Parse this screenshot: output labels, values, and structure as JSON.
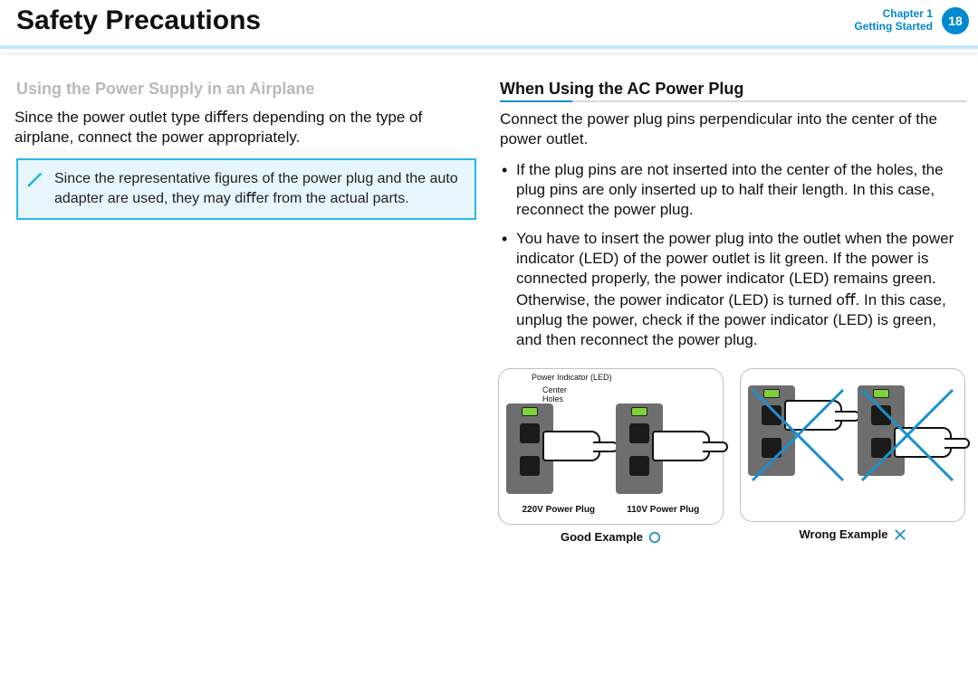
{
  "header": {
    "title": "Safety Precautions",
    "chapter_line1": "Chapter 1",
    "chapter_line2": "Getting Started",
    "page_number": "18"
  },
  "left_col": {
    "section_title": "Using the Power Supply in an Airplane",
    "intro": "Since the power outlet type diﬀers depending on the type of airplane, connect the power appropriately.",
    "note": "Since the representative ﬁgures of the power plug and the auto adapter are used, they may diﬀer from the actual parts."
  },
  "right_col": {
    "section_title": "When Using the AC Power Plug",
    "intro": "Connect the power plug pins perpendicular into the center of the power outlet.",
    "bullets": [
      "If the plug pins are not inserted into the center of the holes, the plug pins are only inserted up to half their length. In this case, reconnect the power plug.",
      "You have to insert the power plug into the outlet when the power indicator (LED) of the power outlet is lit green. If the power is connected properly, the power indicator (LED) remains green."
    ],
    "otherwise": "Otherwise, the power indicator (LED) is turned oﬀ. In this case, unplug the power, check if the power indicator (LED) is green, and then reconnect the power plug.",
    "diagram": {
      "power_indicator_label": "Power Indicator (LED)",
      "center_holes_label": "Center\nHoles",
      "plug220": "220V Power Plug",
      "plug110": "110V Power Plug",
      "good": "Good Example",
      "wrong": "Wrong Example"
    }
  }
}
